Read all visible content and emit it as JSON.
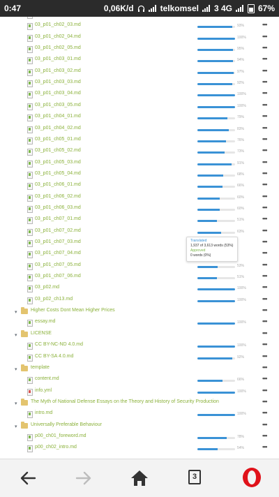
{
  "statusbar": {
    "time": "0:47",
    "speed": "0,06K/d",
    "carrier": "telkomsel",
    "network": "3  4G",
    "battery": "67%"
  },
  "rows": [
    {
      "type": "file",
      "name": "03_p01_ch02_02.md",
      "progress": 0.95,
      "percent": "95%",
      "icon": "md"
    },
    {
      "type": "file",
      "name": "03_p01_ch02_03.md",
      "progress": 0.93,
      "percent": "93%",
      "icon": "md"
    },
    {
      "type": "file",
      "name": "03_p01_ch02_04.md",
      "progress": 1.0,
      "percent": "100%",
      "icon": "md"
    },
    {
      "type": "file",
      "name": "03_p01_ch02_05.md",
      "progress": 0.95,
      "percent": "95%",
      "icon": "md"
    },
    {
      "type": "file",
      "name": "03_p01_ch03_01.md",
      "progress": 0.94,
      "percent": "94%",
      "icon": "md"
    },
    {
      "type": "file",
      "name": "03_p01_ch03_02.md",
      "progress": 0.97,
      "percent": "97%",
      "icon": "md"
    },
    {
      "type": "file",
      "name": "03_p01_ch03_03.md",
      "progress": 0.92,
      "percent": "92%",
      "icon": "md"
    },
    {
      "type": "file",
      "name": "03_p01_ch03_04.md",
      "progress": 1.0,
      "percent": "100%",
      "icon": "md"
    },
    {
      "type": "file",
      "name": "03_p01_ch03_05.md",
      "progress": 1.0,
      "percent": "100%",
      "icon": "md"
    },
    {
      "type": "file",
      "name": "03_p01_ch04_01.md",
      "progress": 0.79,
      "percent": "79%",
      "icon": "md"
    },
    {
      "type": "file",
      "name": "03_p01_ch04_02.md",
      "progress": 0.83,
      "percent": "83%",
      "icon": "md"
    },
    {
      "type": "file",
      "name": "03_p01_ch05_01.md",
      "progress": 0.76,
      "percent": "76%",
      "icon": "md"
    },
    {
      "type": "file",
      "name": "03_p01_ch05_02.md",
      "progress": 0.73,
      "percent": "73%",
      "icon": "md"
    },
    {
      "type": "file",
      "name": "03_p01_ch05_03.md",
      "progress": 0.91,
      "percent": "91%",
      "icon": "md"
    },
    {
      "type": "file",
      "name": "03_p01_ch05_04.md",
      "progress": 0.68,
      "percent": "68%",
      "icon": "md"
    },
    {
      "type": "file",
      "name": "03_p01_ch06_01.md",
      "progress": 0.66,
      "percent": "66%",
      "icon": "md"
    },
    {
      "type": "file",
      "name": "03_p01_ch06_02.md",
      "progress": 0.6,
      "percent": "60%",
      "icon": "md"
    },
    {
      "type": "file",
      "name": "03_p01_ch06_03.md",
      "progress": 0.6,
      "percent": "60%",
      "icon": "md"
    },
    {
      "type": "file",
      "name": "03_p01_ch07_01.md",
      "progress": 0.51,
      "percent": "51%",
      "icon": "md"
    },
    {
      "type": "file",
      "name": "03_p01_ch07_02.md",
      "progress": 0.63,
      "percent": "63%",
      "icon": "md"
    },
    {
      "type": "file",
      "name": "03_p01_ch07_03.md",
      "progress": 0.0,
      "percent": "",
      "icon": "md"
    },
    {
      "type": "file",
      "name": "03_p01_ch07_04.md",
      "progress": 0.0,
      "percent": "",
      "icon": "md"
    },
    {
      "type": "file",
      "name": "03_p01_ch07_05.md",
      "progress": 0.53,
      "percent": "53%",
      "icon": "md"
    },
    {
      "type": "file",
      "name": "03_p01_ch07_06.md",
      "progress": 0.51,
      "percent": "51%",
      "icon": "md"
    },
    {
      "type": "file",
      "name": "03_p02.md",
      "progress": 1.0,
      "percent": "100%",
      "icon": "md"
    },
    {
      "type": "file",
      "name": "03_p02_ch13.md",
      "progress": 1.0,
      "percent": "100%",
      "icon": "md"
    },
    {
      "type": "folder",
      "name": "Higher Costs Dont Mean Higher Prices"
    },
    {
      "type": "file",
      "name": "essay.md",
      "progress": 1.0,
      "percent": "100%",
      "icon": "md"
    },
    {
      "type": "folder",
      "name": "LICENSE"
    },
    {
      "type": "file",
      "name": "CC BY-NC-ND 4.0.md",
      "progress": 1.0,
      "percent": "100%",
      "icon": "md"
    },
    {
      "type": "file",
      "name": "CC BY-SA 4.0.md",
      "progress": 0.92,
      "percent": "92%",
      "icon": "md"
    },
    {
      "type": "folder",
      "name": "template"
    },
    {
      "type": "file",
      "name": "content.md",
      "progress": 0.66,
      "percent": "66%",
      "icon": "md"
    },
    {
      "type": "file",
      "name": "info.yml",
      "progress": 1.0,
      "percent": "100%",
      "icon": "yml"
    },
    {
      "type": "folder",
      "name": "The Myth of National Defense Essays on the Theory and History of Security Production"
    },
    {
      "type": "file",
      "name": "intro.md",
      "progress": 1.0,
      "percent": "100%",
      "icon": "md"
    },
    {
      "type": "folder",
      "name": "Universally Preferable Behaviour"
    },
    {
      "type": "file",
      "name": "p00_ch01_foreword.md",
      "progress": 0.78,
      "percent": "78%",
      "icon": "md"
    },
    {
      "type": "file",
      "name": "p00_ch02_intro.md",
      "progress": 0.54,
      "percent": "54%",
      "icon": "md"
    }
  ],
  "tooltip": {
    "translated_label": "Translated",
    "translated_value": "1,937 of 3,613 words (53%)",
    "approved_label": "Approved",
    "approved_value": "0 words (0%)"
  },
  "nav": {
    "back_icon": "back-arrow-icon",
    "forward_icon": "forward-arrow-icon",
    "home_icon": "home-icon",
    "tab_count": "3",
    "menu_icon": "opera-icon"
  },
  "colors": {
    "progress": "#3a92d6",
    "filename": "#8ab13a",
    "folder": "#e3c46f",
    "opera": "#e0121a"
  }
}
